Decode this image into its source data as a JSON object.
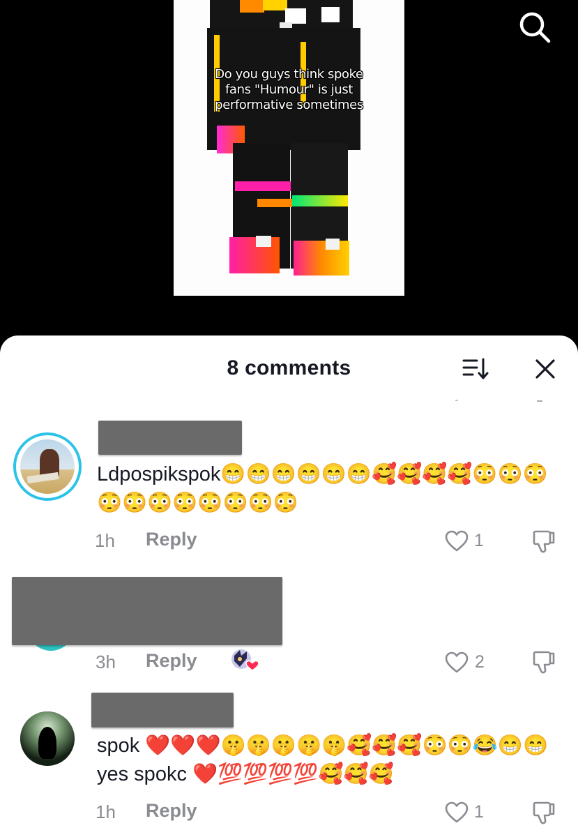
{
  "video": {
    "caption_lines": [
      "Do you guys think spoke",
      "fans \"Humour\" is just",
      "performative sometimes"
    ],
    "search_icon": "search-icon"
  },
  "comments_panel": {
    "title": "8 comments",
    "sort_icon": "sort-icon",
    "close_icon": "close-icon"
  },
  "comments": [
    {
      "username_redacted": true,
      "text": "Ldpospikspok😁😁😁😁😁😁🥰🥰🥰🥰😳😳😳😳😳😳😳😳😳😳😳",
      "time": "1h",
      "reply_label": "Reply",
      "likes": "1",
      "creator_liked": false
    },
    {
      "username_redacted": true,
      "text_redacted": true,
      "time": "3h",
      "reply_label": "Reply",
      "likes": "2",
      "creator_liked": true
    },
    {
      "username_redacted": true,
      "text": "spok ❤️❤️❤️🤫🤫🤫🤫🤫🥰🥰🥰😳😳😂😁😁yes spokc ❤️💯💯💯💯🥰🥰🥰",
      "time": "1h",
      "reply_label": "Reply",
      "likes": "1",
      "creator_liked": false
    }
  ],
  "colors": {
    "background": "#000000",
    "sheet": "#ffffff",
    "text_primary": "#161823",
    "text_secondary": "#8a8b91",
    "avatar_ring": "#2dc3e8"
  }
}
